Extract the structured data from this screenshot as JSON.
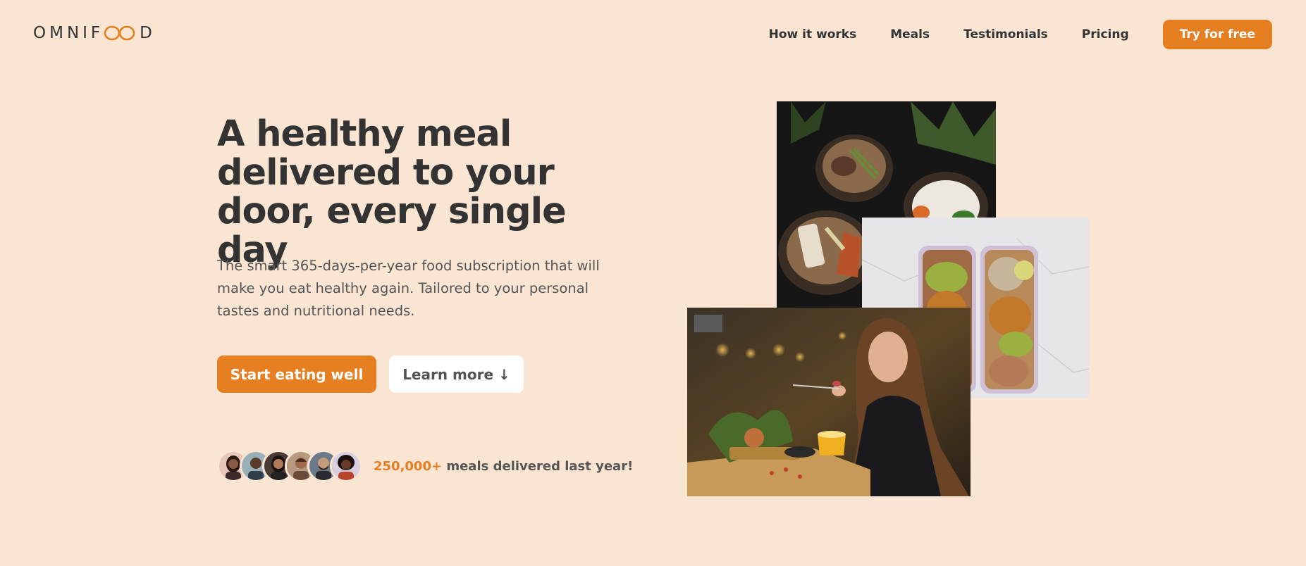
{
  "header": {
    "logo": {
      "prefix": "OMNIF",
      "suffix": "D",
      "icon": "infinity-icon"
    },
    "nav": [
      {
        "label": "How it works"
      },
      {
        "label": "Meals"
      },
      {
        "label": "Testimonials"
      },
      {
        "label": "Pricing"
      }
    ],
    "cta_label": "Try for free"
  },
  "hero": {
    "title": "A healthy meal delivered to your door, every single day",
    "description": "The smart 365-days-per-year food subscription that will make you eat healthy again. Tailored to your personal tastes and nutritional needs.",
    "primary_button": "Start eating well",
    "secondary_button": "Learn more ↓",
    "delivered": {
      "count": "250,000+",
      "text": " meals delivered last year!"
    }
  },
  "colors": {
    "background": "#fae5d3",
    "accent": "#e67e22",
    "text": "#333333",
    "muted_text": "#555555"
  }
}
